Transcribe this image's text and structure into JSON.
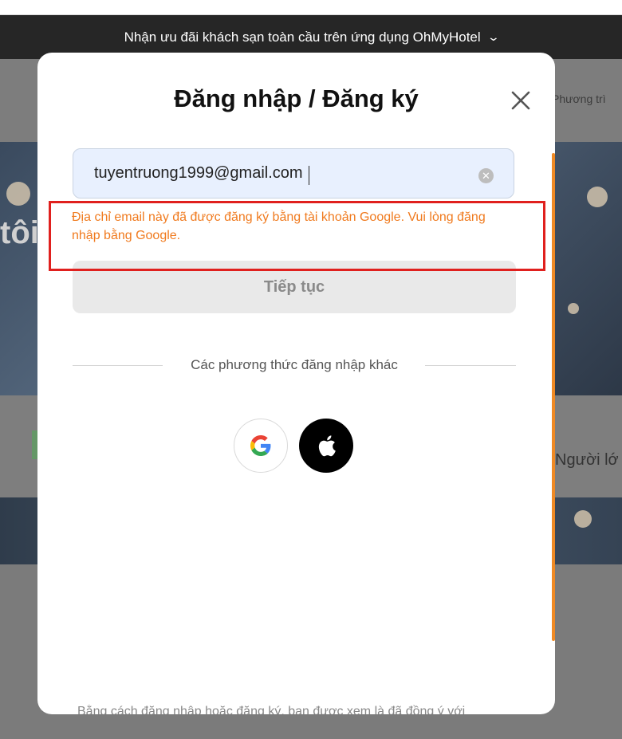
{
  "banner": {
    "text": "Nhận ưu đãi khách sạn toàn cầu trên ứng dụng OhMyHotel",
    "chevron_icon": "chevron-down-icon"
  },
  "background": {
    "text_left": "tôi",
    "text_right_top": "Phương trì",
    "text_right_mid": "Người lớ"
  },
  "modal": {
    "title": "Đăng nhập / Đăng ký",
    "close_icon": "close-icon",
    "email": {
      "value": "tuyentruong1999@gmail.com",
      "clear_icon": "clear-circle-icon"
    },
    "error_message": "Địa chỉ email này đã được đăng ký bằng tài khoản Google. Vui lòng đăng nhập bằng Google.",
    "continue_label": "Tiếp tục",
    "other_methods_label": "Các phương thức đăng nhập khác",
    "social": [
      {
        "name": "Google",
        "icon": "google-icon"
      },
      {
        "name": "Apple",
        "icon": "apple-icon"
      }
    ],
    "terms_text": "Bằng cách đăng nhập hoặc đăng ký, bạn được xem là đã đồng ý với"
  },
  "colors": {
    "error": "#f07a1e",
    "highlight": "#e0201e",
    "scrollbar": "#f08a24",
    "input_bg": "#e8f0fe"
  }
}
